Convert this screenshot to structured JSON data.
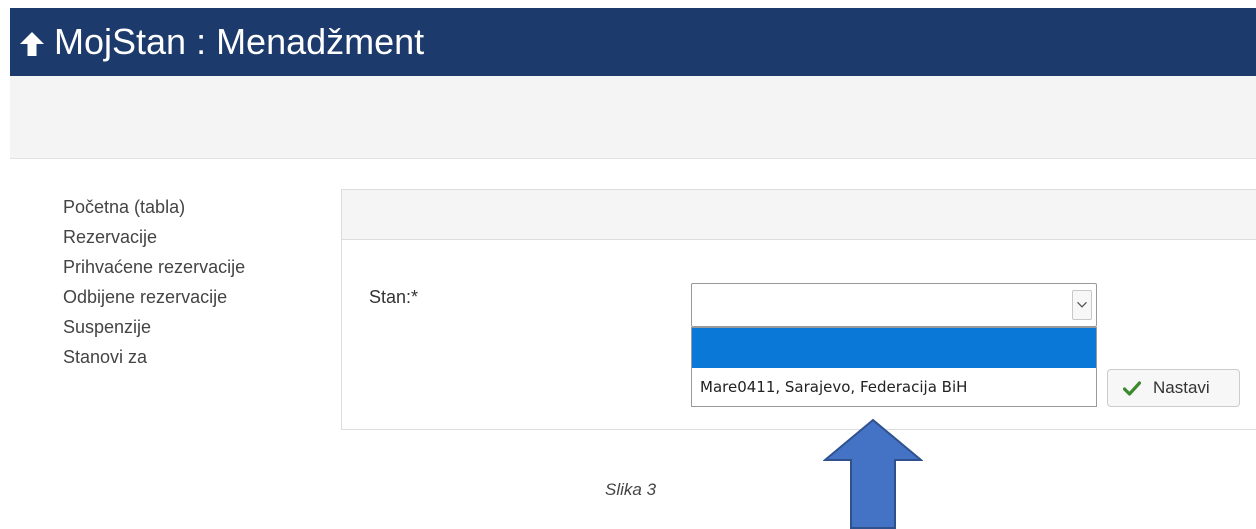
{
  "header": {
    "title": "MojStan : Menadžment",
    "icon": "arrow-up-icon",
    "bg_color": "#1c3a6b"
  },
  "sidebar": {
    "items": [
      {
        "label": "Početna (tabla)"
      },
      {
        "label": "Rezervacije"
      },
      {
        "label": "Prihvaćene rezervacije"
      },
      {
        "label": "Odbijene rezervacije"
      },
      {
        "label": "Suspenzije"
      },
      {
        "label": "Stanovi za"
      }
    ]
  },
  "form": {
    "stan_label": "Stan:*",
    "select_value": "",
    "dropdown_options": [
      "",
      "Mare0411, Sarajevo, Federacija BiH"
    ],
    "highlight_color": "#0a78d7",
    "submit_label": "Nastavi",
    "submit_icon": "checkmark-icon"
  },
  "caption": "Slika 3",
  "annotation": {
    "icon": "arrow-up-annotation",
    "color": "#4472c4"
  }
}
